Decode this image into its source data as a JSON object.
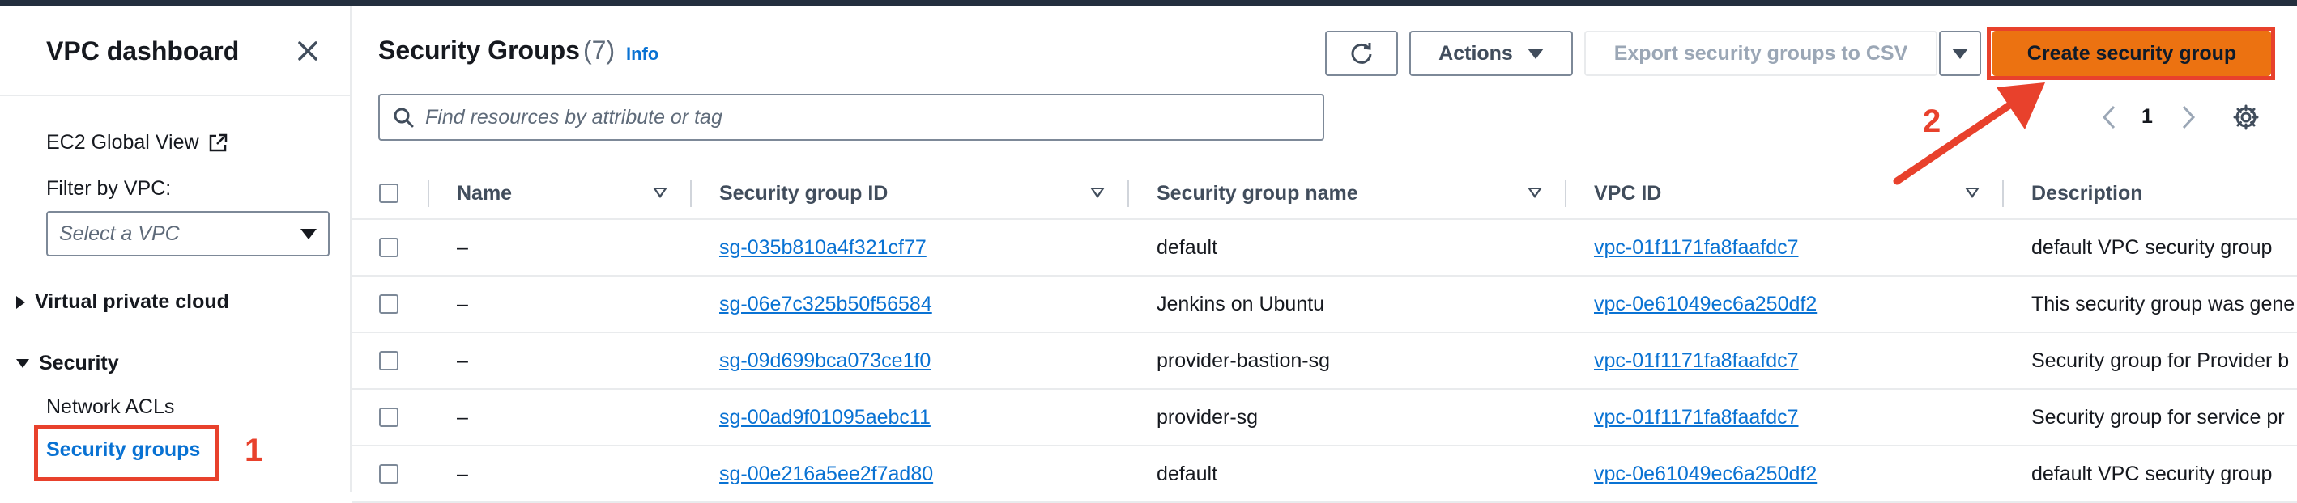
{
  "sidebar": {
    "title": "VPC dashboard",
    "ec2_global_view": "EC2 Global View",
    "filter_label": "Filter by VPC:",
    "filter_placeholder": "Select a VPC",
    "sections": [
      {
        "label": "Virtual private cloud",
        "expanded": false
      },
      {
        "label": "Security",
        "expanded": true
      }
    ],
    "security_items": [
      "Network ACLs",
      "Security groups"
    ],
    "active_item": "Security groups"
  },
  "header": {
    "title": "Security Groups",
    "count": "(7)",
    "info": "Info",
    "actions_label": "Actions",
    "export_label": "Export security groups to CSV",
    "create_label": "Create security group"
  },
  "search": {
    "placeholder": "Find resources by attribute or tag"
  },
  "pagination": {
    "page": "1"
  },
  "annotations": {
    "step1": "1",
    "step2": "2"
  },
  "table": {
    "columns": [
      "Name",
      "Security group ID",
      "Security group name",
      "VPC ID",
      "Description"
    ],
    "rows": [
      {
        "name": "–",
        "id": "sg-035b810a4f321cf77",
        "group_name": "default",
        "vpc": "vpc-01f1171fa8faafdc7",
        "desc": "default VPC security group"
      },
      {
        "name": "–",
        "id": "sg-06e7c325b50f56584",
        "group_name": "Jenkins on Ubuntu",
        "vpc": "vpc-0e61049ec6a250df2",
        "desc": "This security group was gene"
      },
      {
        "name": "–",
        "id": "sg-09d699bca073ce1f0",
        "group_name": "provider-bastion-sg",
        "vpc": "vpc-01f1171fa8faafdc7",
        "desc": "Security group for Provider b"
      },
      {
        "name": "–",
        "id": "sg-00ad9f01095aebc11",
        "group_name": "provider-sg",
        "vpc": "vpc-01f1171fa8faafdc7",
        "desc": "Security group for service pr"
      },
      {
        "name": "–",
        "id": "sg-00e216a5ee2f7ad80",
        "group_name": "default",
        "vpc": "vpc-0e61049ec6a250df2",
        "desc": "default VPC security group"
      }
    ]
  },
  "colors": {
    "primary_button": "#ec7211",
    "link": "#0972d3",
    "annotation": "#e8412c",
    "topbar": "#232f3e"
  }
}
